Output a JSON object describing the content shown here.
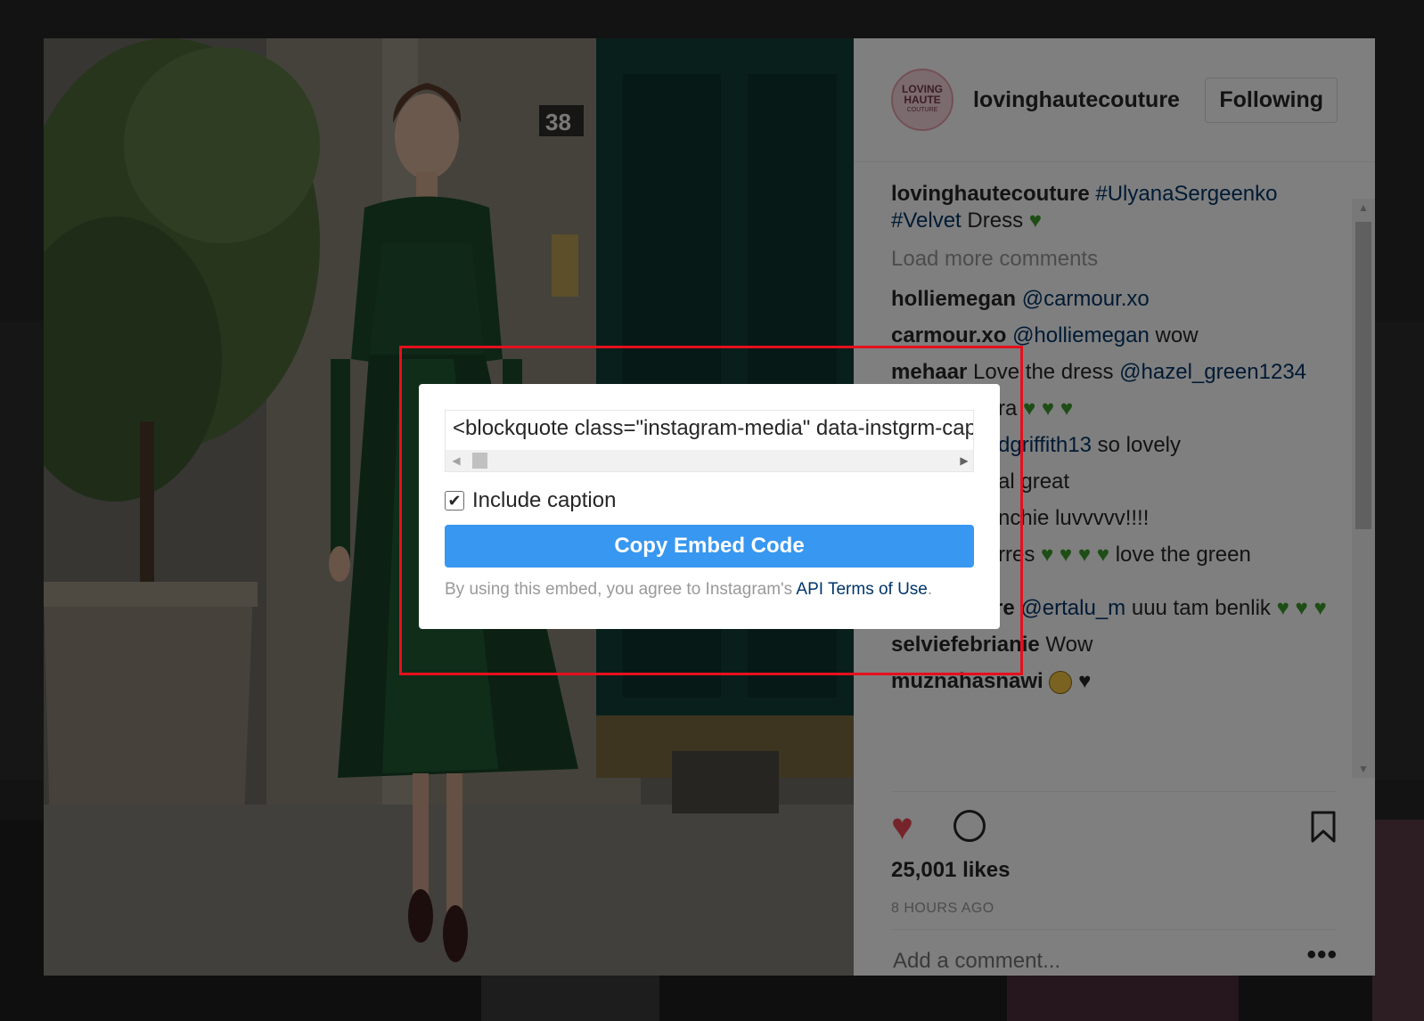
{
  "post": {
    "username": "lovinghautecouture",
    "avatar": {
      "line1": "LOVING",
      "line2": "HAUTE",
      "line3": "COUTURE"
    },
    "follow_label": "Following",
    "photo_number": "38",
    "caption": {
      "user": "lovinghautecouture",
      "tag1": "#UlyanaSergeenko",
      "tag2": "#Velvet",
      "text": " Dress "
    },
    "load_more": "Load more comments",
    "comments": [
      {
        "user": "holliemegan",
        "tag": "@carmour.xo",
        "text": ""
      },
      {
        "user": "carmour.xo",
        "tag": "@holliemegan",
        "text": " wow"
      },
      {
        "user": "mehaar",
        "text_pre": " Love the dress ",
        "tag": "@hazel_green1234"
      },
      {
        "user": "",
        "text": "ra"
      },
      {
        "user": "",
        "tag": "dgriffith13",
        "text": " so lovely"
      },
      {
        "user": "",
        "text": "al great"
      },
      {
        "user": "",
        "text": "nchie luvvvvv!!!!"
      },
      {
        "user": "",
        "text": "rres",
        "text_after": " love the green"
      },
      {
        "user": "gizemystere",
        "tag": "@ertalu_m",
        "text": " uuu tam benlik "
      },
      {
        "user": "selviefebrianie",
        "text": " Wow"
      },
      {
        "user": "muznahasnawi",
        "text": ""
      }
    ],
    "likes": "25,001 likes",
    "time": "8 HOURS AGO",
    "add_comment_placeholder": "Add a comment...",
    "more": "•••"
  },
  "embed": {
    "code": "<blockquote class=\"instagram-media\" data-instgrm-captioned data-instgrm-permalink",
    "include_caption_label": "Include caption",
    "copy_button": "Copy Embed Code",
    "terms_prefix": "By using this embed, you agree to Instagram's ",
    "terms_link": "API Terms of Use",
    "terms_suffix": "."
  },
  "colors": {
    "accent": "#3897f0",
    "link": "#003569",
    "like": "#ed4956",
    "highlight": "#e5101d"
  },
  "icons": [
    "heart-icon",
    "comment-icon",
    "bookmark-icon",
    "green-heart-icon",
    "black-heart-icon",
    "smiley-icon",
    "check-icon",
    "scroll-arrow-icon"
  ]
}
